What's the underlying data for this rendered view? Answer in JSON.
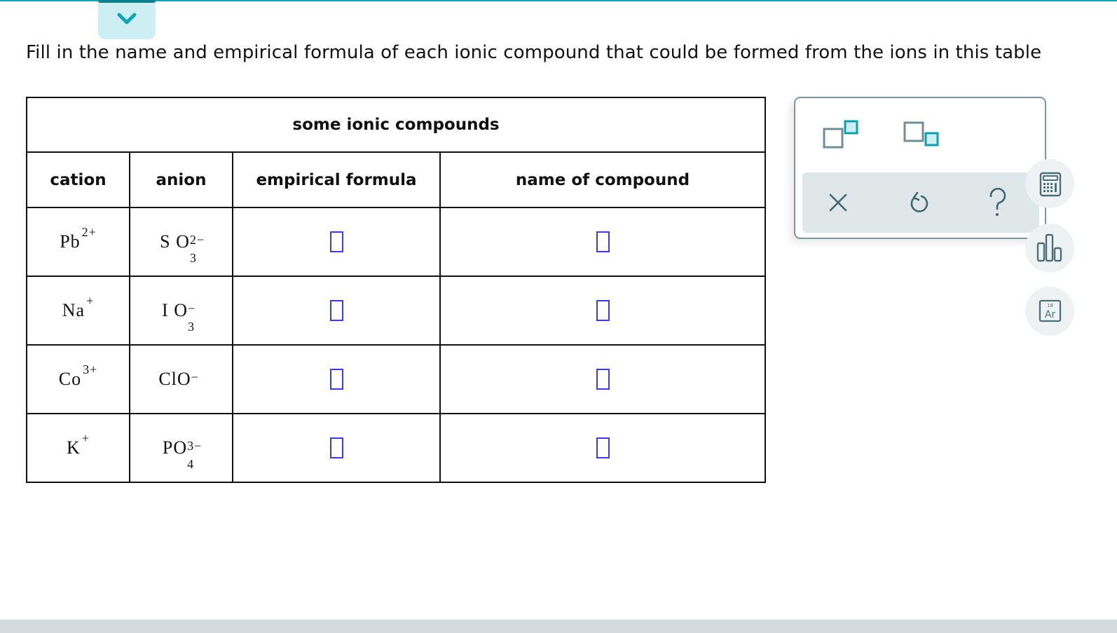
{
  "header": {
    "collapse_button": "chevron-down",
    "prompt": "Fill in the name and empirical formula of each ionic compound that could be formed from the ions in this table"
  },
  "table": {
    "caption": "some ionic compounds",
    "columns": [
      "cation",
      "anion",
      "empirical formula",
      "name of compound"
    ],
    "rows": [
      {
        "cation": {
          "symbol": "Pb",
          "charge": "2+"
        },
        "anion": {
          "symbol": "S O",
          "subscript": "3",
          "charge": "2−"
        },
        "empirical_formula": "",
        "name": ""
      },
      {
        "cation": {
          "symbol": "Na",
          "charge": "+"
        },
        "anion": {
          "symbol": "I O",
          "subscript": "3",
          "charge": "−"
        },
        "empirical_formula": "",
        "name": ""
      },
      {
        "cation": {
          "symbol": "Co",
          "charge": "3+"
        },
        "anion": {
          "symbol": "ClO",
          "subscript": "",
          "charge": "−"
        },
        "empirical_formula": "",
        "name": ""
      },
      {
        "cation": {
          "symbol": "K",
          "charge": "+"
        },
        "anion": {
          "symbol": "PO",
          "subscript": "4",
          "charge": "3−"
        },
        "empirical_formula": "",
        "name": ""
      }
    ]
  },
  "tools": {
    "superscript": "superscript-template",
    "subscript": "subscript-template",
    "clear": "clear",
    "undo": "undo",
    "help": "help"
  },
  "side_tools": {
    "calculator": "calculator",
    "data": "chart",
    "periodic_table": {
      "number": "18",
      "symbol": "Ar"
    }
  },
  "colors": {
    "accent": "#11a6b8",
    "input_border": "#3a3af0",
    "icon": "#4b6f78"
  }
}
